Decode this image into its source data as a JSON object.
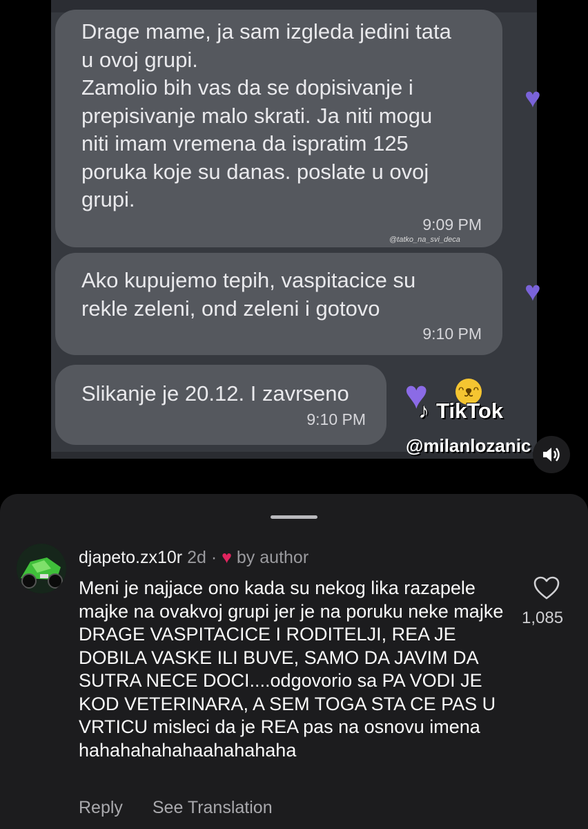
{
  "video": {
    "messages": [
      {
        "text": "Drage mame, ja sam izgleda jedini tata\nu ovoj grupi.\nZamolio bih vas da se dopisivanje i\nprepisivanje malo skrati. Ja niti mogu\nniti imam vremena da ispratim 125\nporuka koje su danas. poslate u ovoj\ngrupi.",
        "time": "9:09 PM"
      },
      {
        "text": "Ako kupujemo tepih, vaspitacice su\nrekle zeleni, ond zeleni i gotovo",
        "time": "9:10 PM"
      },
      {
        "text": "Slikanje je 20.12. I zavrseno",
        "time": "9:10 PM"
      }
    ],
    "small_watermark": "@tatko_na_svi_deca",
    "tiktok_brand": "TikTok",
    "tiktok_handle": "@milanlozanic",
    "mute_icon": "speaker-icon"
  },
  "comment": {
    "username": "djapeto.zx10r",
    "age": "2d",
    "separator": "·",
    "liked_by": "by author",
    "text": "Meni je najjace ono kada su nekog lika razapele majke na ovakvoj grupi jer je na poruku neke majke DRAGE VASPITACICE I RODITELJI, REA JE DOBILA VASKE ILI BUVE, SAMO DA JAVIM DA SUTRA NECE DOCI....odgovorio sa PA VODI JE KOD VETERINARA, A SEM TOGA STA CE PAS U VRTICU misleci da je REA pas na osnovu imena hahahahahahaahahahaha",
    "like_count": "1,085",
    "reply_label": "Reply",
    "translate_label": "See Translation"
  },
  "colors": {
    "accent_heart": "#e0245e",
    "bubble": "#55585e",
    "panel": "#1c1c1e"
  }
}
